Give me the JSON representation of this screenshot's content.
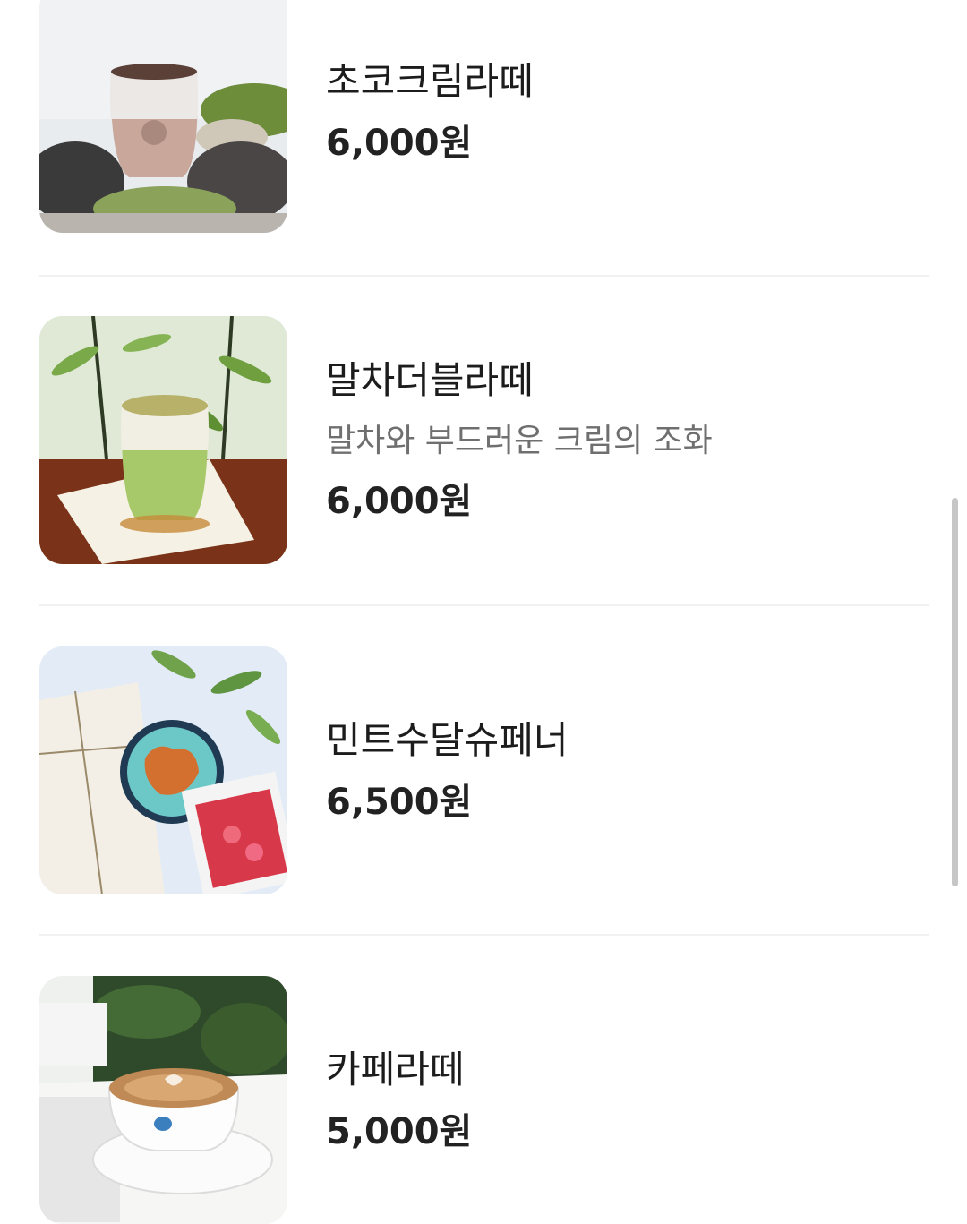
{
  "menu": {
    "items": [
      {
        "name": "초코크림라떼",
        "description": "",
        "price": "6,000원"
      },
      {
        "name": "말차더블라떼",
        "description": "말차와 부드러운 크림의 조화",
        "price": "6,000원"
      },
      {
        "name": "민트수달슈페너",
        "description": "",
        "price": "6,500원"
      },
      {
        "name": "카페라떼",
        "description": "",
        "price": "5,000원"
      }
    ]
  },
  "colors": {
    "text": "#1c1c1c",
    "description": "#6f6f6f",
    "divider": "#f1f1f1",
    "scrollbar": "#c6c6c6"
  }
}
